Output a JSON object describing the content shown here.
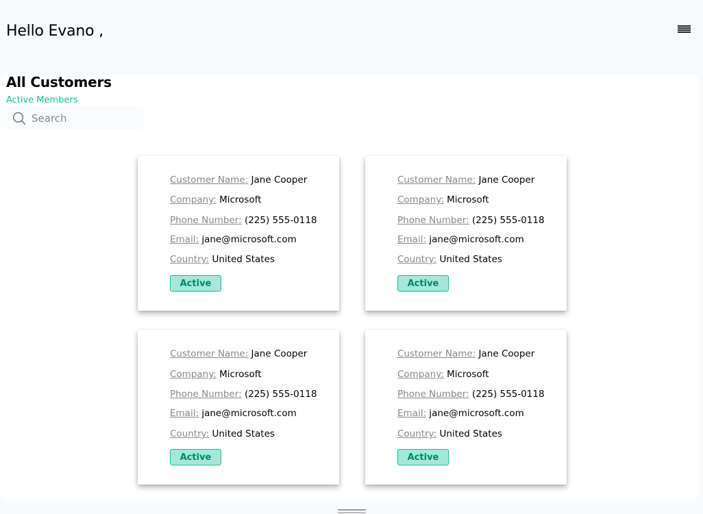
{
  "header": {
    "greeting": "Hello Evano ,"
  },
  "menu_icon": "hamburger-menu-icon",
  "section": {
    "title": "All Customers",
    "subtitle": "Active Members"
  },
  "search": {
    "placeholder": "Search",
    "value": ""
  },
  "labels": {
    "name": "Customer Name:",
    "company": "Company:",
    "phone": "Phone Number:",
    "email": "Email:",
    "country": "Country:"
  },
  "customers": [
    {
      "name": "Jane Cooper",
      "company": "Microsoft",
      "phone": "(225) 555-0118",
      "email": "jane@microsoft.com",
      "country": "United States",
      "status": "Active"
    },
    {
      "name": "Jane Cooper",
      "company": "Microsoft",
      "phone": "(225) 555-0118",
      "email": "jane@microsoft.com",
      "country": "United States",
      "status": "Active"
    },
    {
      "name": "Jane Cooper",
      "company": "Microsoft",
      "phone": "(225) 555-0118",
      "email": "jane@microsoft.com",
      "country": "United States",
      "status": "Active"
    },
    {
      "name": "Jane Cooper",
      "company": "Microsoft",
      "phone": "(225) 555-0118",
      "email": "jane@microsoft.com",
      "country": "United States",
      "status": "Active"
    }
  ],
  "colors": {
    "accent": "#16c098",
    "status_bg": "#a6e7d8",
    "status_text": "#008767",
    "page_bg": "#f9fafe"
  }
}
